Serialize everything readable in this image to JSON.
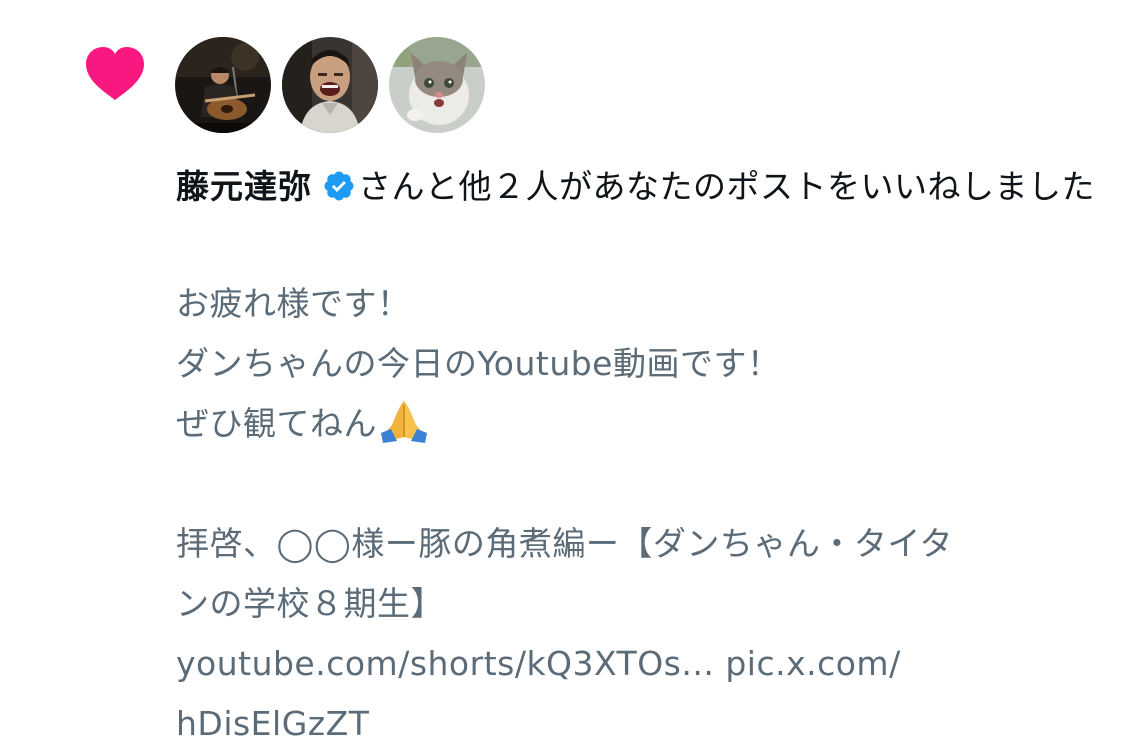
{
  "notification": {
    "type_icon": "heart-icon",
    "type_icon_color": "#f91880",
    "avatars": [
      {
        "icon": "avatar-guitarist"
      },
      {
        "icon": "avatar-laughing-man"
      },
      {
        "icon": "avatar-kitten"
      }
    ],
    "liker_name": "藤元達弥",
    "verified_icon": "verified-badge-icon",
    "verified_color": "#1d9bf0",
    "action_text": "さんと他２人があなたのポストをいいねしました",
    "text_color": "#0f1419",
    "post_text_color": "#5b6b78",
    "post": {
      "line1": "お疲れ様です！",
      "line2": "ダンちゃんの今日のYoutube動画です！",
      "line3": "ぜひ観てねん",
      "emoji": "folded-hands-emoji",
      "line4": "拝啓、◯◯様ー豚の角煮編ー【ダンちゃん・タイタ",
      "line5": "ンの学校８期生】",
      "line6": "youtube.com/shorts/kQ3XTOs... pic.x.com/",
      "line7": "hDisElGzZT"
    }
  }
}
